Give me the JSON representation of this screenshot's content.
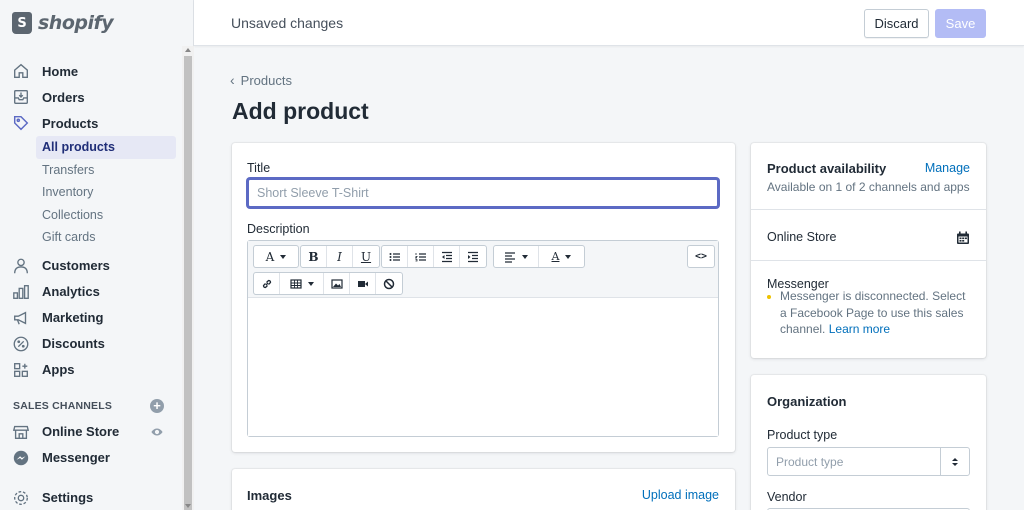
{
  "brand": {
    "logo_text": "shopify",
    "logo_mark": "S"
  },
  "topbar": {
    "status": "Unsaved changes",
    "discard_label": "Discard",
    "save_label": "Save"
  },
  "sidebar": {
    "items": [
      {
        "label": "Home",
        "icon": "home-icon"
      },
      {
        "label": "Orders",
        "icon": "orders-icon"
      },
      {
        "label": "Products",
        "icon": "tag-icon"
      }
    ],
    "products_sub": [
      "All products",
      "Transfers",
      "Inventory",
      "Collections",
      "Gift cards"
    ],
    "items2": [
      {
        "label": "Customers",
        "icon": "person-icon"
      },
      {
        "label": "Analytics",
        "icon": "chart-icon"
      },
      {
        "label": "Marketing",
        "icon": "megaphone-icon"
      },
      {
        "label": "Discounts",
        "icon": "discount-icon"
      },
      {
        "label": "Apps",
        "icon": "apps-icon"
      }
    ],
    "sales_channels_title": "SALES CHANNELS",
    "channels": [
      {
        "label": "Online Store",
        "icon": "store-icon"
      },
      {
        "label": "Messenger",
        "icon": "messenger-icon"
      }
    ],
    "settings": "Settings"
  },
  "main": {
    "breadcrumb": "Products",
    "page_title": "Add product",
    "title_label": "Title",
    "title_placeholder": "Short Sleeve T-Shirt",
    "description_label": "Description",
    "images_title": "Images",
    "upload_image": "Upload image"
  },
  "availability": {
    "title": "Product availability",
    "manage": "Manage",
    "subtitle": "Available on 1 of 2 channels and apps",
    "online_store": "Online Store",
    "messenger": "Messenger",
    "messenger_note": "Messenger is disconnected. Select a Facebook Page to use this sales channel.",
    "learn_more": "Learn more"
  },
  "organization": {
    "title": "Organization",
    "product_type_label": "Product type",
    "product_type_placeholder": "Product type",
    "vendor_label": "Vendor"
  },
  "colors": {
    "accent": "#5c6ac4",
    "link": "#006fbb",
    "save_disabled": "#b3bcf5",
    "warning_dot": "#eec200"
  }
}
